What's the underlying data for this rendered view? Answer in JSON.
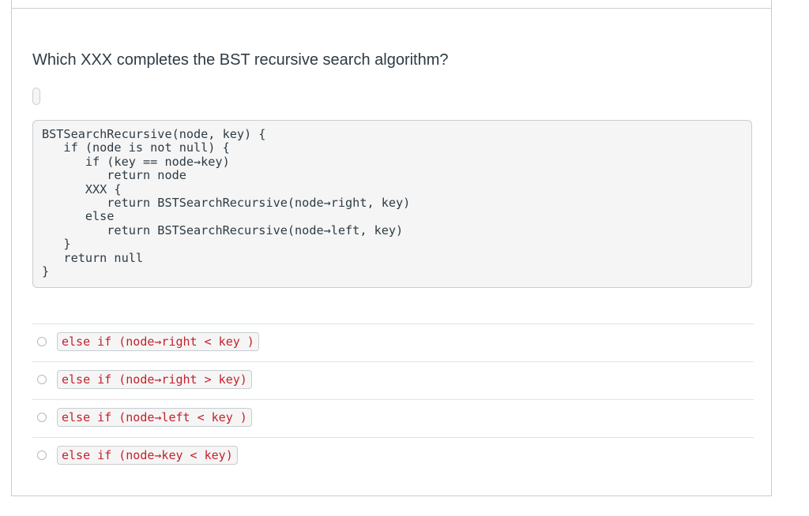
{
  "question": {
    "text": "Which XXX completes the BST recursive search algorithm?"
  },
  "code": {
    "lines": [
      "BSTSearchRecursive(node, key) {",
      "   if (node is not null) {",
      "      if (key == node→key)",
      "         return node",
      "      XXX {",
      "         return BSTSearchRecursive(node→right, key)",
      "      else",
      "         return BSTSearchRecursive(node→left, key)",
      "   }",
      "   return null",
      "}"
    ]
  },
  "answers": [
    {
      "label": "else if (node→right < key )"
    },
    {
      "label": "else if (node→right > key)"
    },
    {
      "label": "else if (node→left < key )"
    },
    {
      "label": "else if (node→key < key)"
    }
  ]
}
